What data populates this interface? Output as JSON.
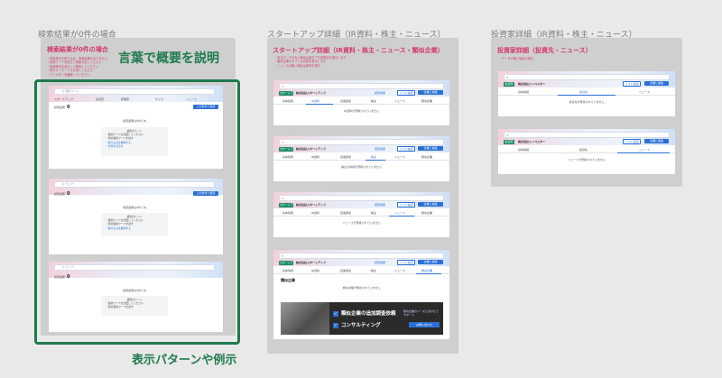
{
  "columns": {
    "search": {
      "label": "検索結果が0件の場合",
      "frame_title": "検索結果が0件の場合",
      "notes": [
        "・検索条件を絞り込み、検索結果がありません。",
        "・検索ワードを変えて再度お試しください",
        "・検索条件を減らして検索してください",
        "・別のキーワードでお試しください",
        "・フィルターを解除してください"
      ],
      "callout_top": "言葉で概要を説明",
      "callout_bottom": "表示パターンや例示"
    },
    "startup": {
      "label": "スタートアップ詳細（IR資料・株主・ニュース）",
      "frame_title": "スタートアップ詳細（IR資料・株主・ニュース・類似企業）",
      "notes": [
        "・該当データがない場合は各タブで説明文を表示します",
        "・類似企業のタブでは広告を表示します",
        "・ニュースが無い場合は案内を表示"
      ]
    },
    "investor": {
      "label": "投資家詳細（IR資料・株主・ニュース）",
      "frame_title": "投資家詳細（投資先・ニュース）",
      "notes": [
        "・データが無い場合の表示"
      ]
    }
  },
  "search_cards": [
    {
      "search_text": "Q  検索ワード",
      "tab_labels": [
        "スタートアップ",
        "投資家",
        "卸業者",
        "サイズ",
        "ニュース"
      ],
      "result_count_label": "検索結果",
      "result_count": "0",
      "save_label": "この条件で保存",
      "empty_message": "検索結果は0件です。",
      "hint_title": "検索のヒント",
      "hints": [
        "・検索ワードを変更してください",
        "・別の検索ワードを試す",
        "・絞り込みを解除する",
        "・条件を見直す"
      ]
    },
    {
      "search_text": "Q  ラップ",
      "tab_labels": [],
      "result_count_label": "検索結果",
      "result_count": "0",
      "save_label": "この条件で保存",
      "empty_message": "検索結果は0件です。",
      "hint_title": "検索のヒント",
      "hints": [
        "・検索ワードを変更してください",
        "・別の検索ワードを試す",
        "・絞り込みを解除する"
      ]
    },
    {
      "search_text": "Q  ラップ",
      "tab_labels": [],
      "result_count_label": "検索結果",
      "result_count": "0",
      "save_label": "",
      "empty_message": "検索結果は0件です。",
      "hint_title": "検索のヒント",
      "hints": [
        "・検索ワードを変更してください",
        "・別の検索ワードを試す"
      ]
    }
  ],
  "startup_cards": [
    {
      "badge": "スタートアップ",
      "company": "株式会社スタートアップ",
      "action_1": "調査依頼",
      "action_2": "リスト追加",
      "action_3": "企業に連絡",
      "tabs": [
        "基本情報",
        "IR資料",
        "資金調達",
        "株主",
        "ニュース",
        "類似企業"
      ],
      "active_tab": 1,
      "empty_message": "IR資料が登録されていません"
    },
    {
      "badge": "スタートアップ",
      "company": "株式会社スタートアップ",
      "action_1": "調査依頼",
      "action_2": "リスト追加",
      "action_3": "企業に連絡",
      "tabs": [
        "基本情報",
        "IR資料",
        "資金調達",
        "株主",
        "ニュース",
        "類似企業"
      ],
      "active_tab": 3,
      "empty_message": "株主の情報が登録されていません"
    },
    {
      "badge": "スタートアップ",
      "company": "株式会社スタートアップ",
      "action_1": "調査依頼",
      "action_2": "リスト追加",
      "action_3": "企業に連絡",
      "tabs": [
        "基本情報",
        "IR資料",
        "資金調達",
        "株主",
        "ニュース",
        "類似企業"
      ],
      "active_tab": 4,
      "empty_message": "ニュースが登録されていません"
    },
    {
      "badge": "スタートアップ",
      "company": "株式会社スタートアップ",
      "action_1": "調査依頼",
      "action_2": "リスト追加",
      "action_3": "企業に連絡",
      "tabs": [
        "基本情報",
        "IR資料",
        "資金調達",
        "株主",
        "ニュース",
        "類似企業"
      ],
      "active_tab": 5,
      "section_title": "類似企業",
      "empty_message": "類似企業が登録されていません",
      "ad": {
        "line_1": "類似企業の追加調査依頼",
        "line_2": "コンサルティング",
        "side_text": "類似企業のニーズに合わせてサポート",
        "cta": "お問い合わせ"
      }
    }
  ],
  "investor_cards": [
    {
      "badge": "投資家",
      "company": "株式会社インベスター",
      "action_1": "リスト追加",
      "action_2": "企業に連絡",
      "tabs": [
        "基本情報",
        "投資先",
        "ニュース"
      ],
      "active_tab": 1,
      "empty_message": "投資先が登録されていません"
    },
    {
      "badge": "投資家",
      "company": "株式会社インベスター",
      "action_1": "リスト追加",
      "action_2": "企業に連絡",
      "tabs": [
        "基本情報",
        "投資先",
        "ニュース"
      ],
      "active_tab": 2,
      "empty_message": "ニュースが登録されていません"
    }
  ]
}
